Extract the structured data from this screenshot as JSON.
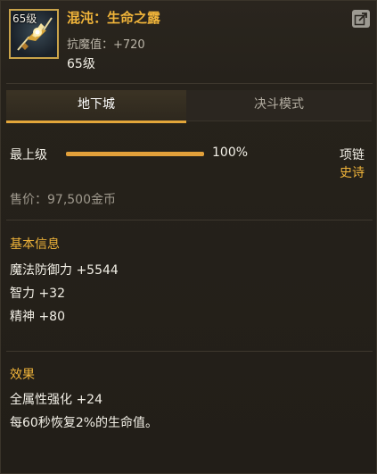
{
  "item": {
    "icon_level": "65级",
    "name": "混沌：生命之露",
    "stat_line": "抗魔值：+720",
    "level": "65级"
  },
  "tabs": [
    {
      "label": "地下城",
      "active": true
    },
    {
      "label": "决斗模式",
      "active": false
    }
  ],
  "level_info": {
    "label": "最上级",
    "percent_text": "100%",
    "fill_fraction": 1.0,
    "slot": "项链",
    "rarity": "史诗"
  },
  "price": "售价：97,500金币",
  "basic_info": {
    "title": "基本信息",
    "lines": [
      "魔法防御力 +5544",
      "智力 +32",
      "精神 +80"
    ]
  },
  "effects": {
    "title": "效果",
    "lines": [
      "全属性强化 +24",
      "每60秒恢复2%的生命值。"
    ]
  },
  "colors": {
    "accent": "#f0b43a",
    "bar": "#e2a03a",
    "background": "#221e18"
  },
  "icons": {
    "item": "necklace-icon",
    "share": "share-icon"
  }
}
